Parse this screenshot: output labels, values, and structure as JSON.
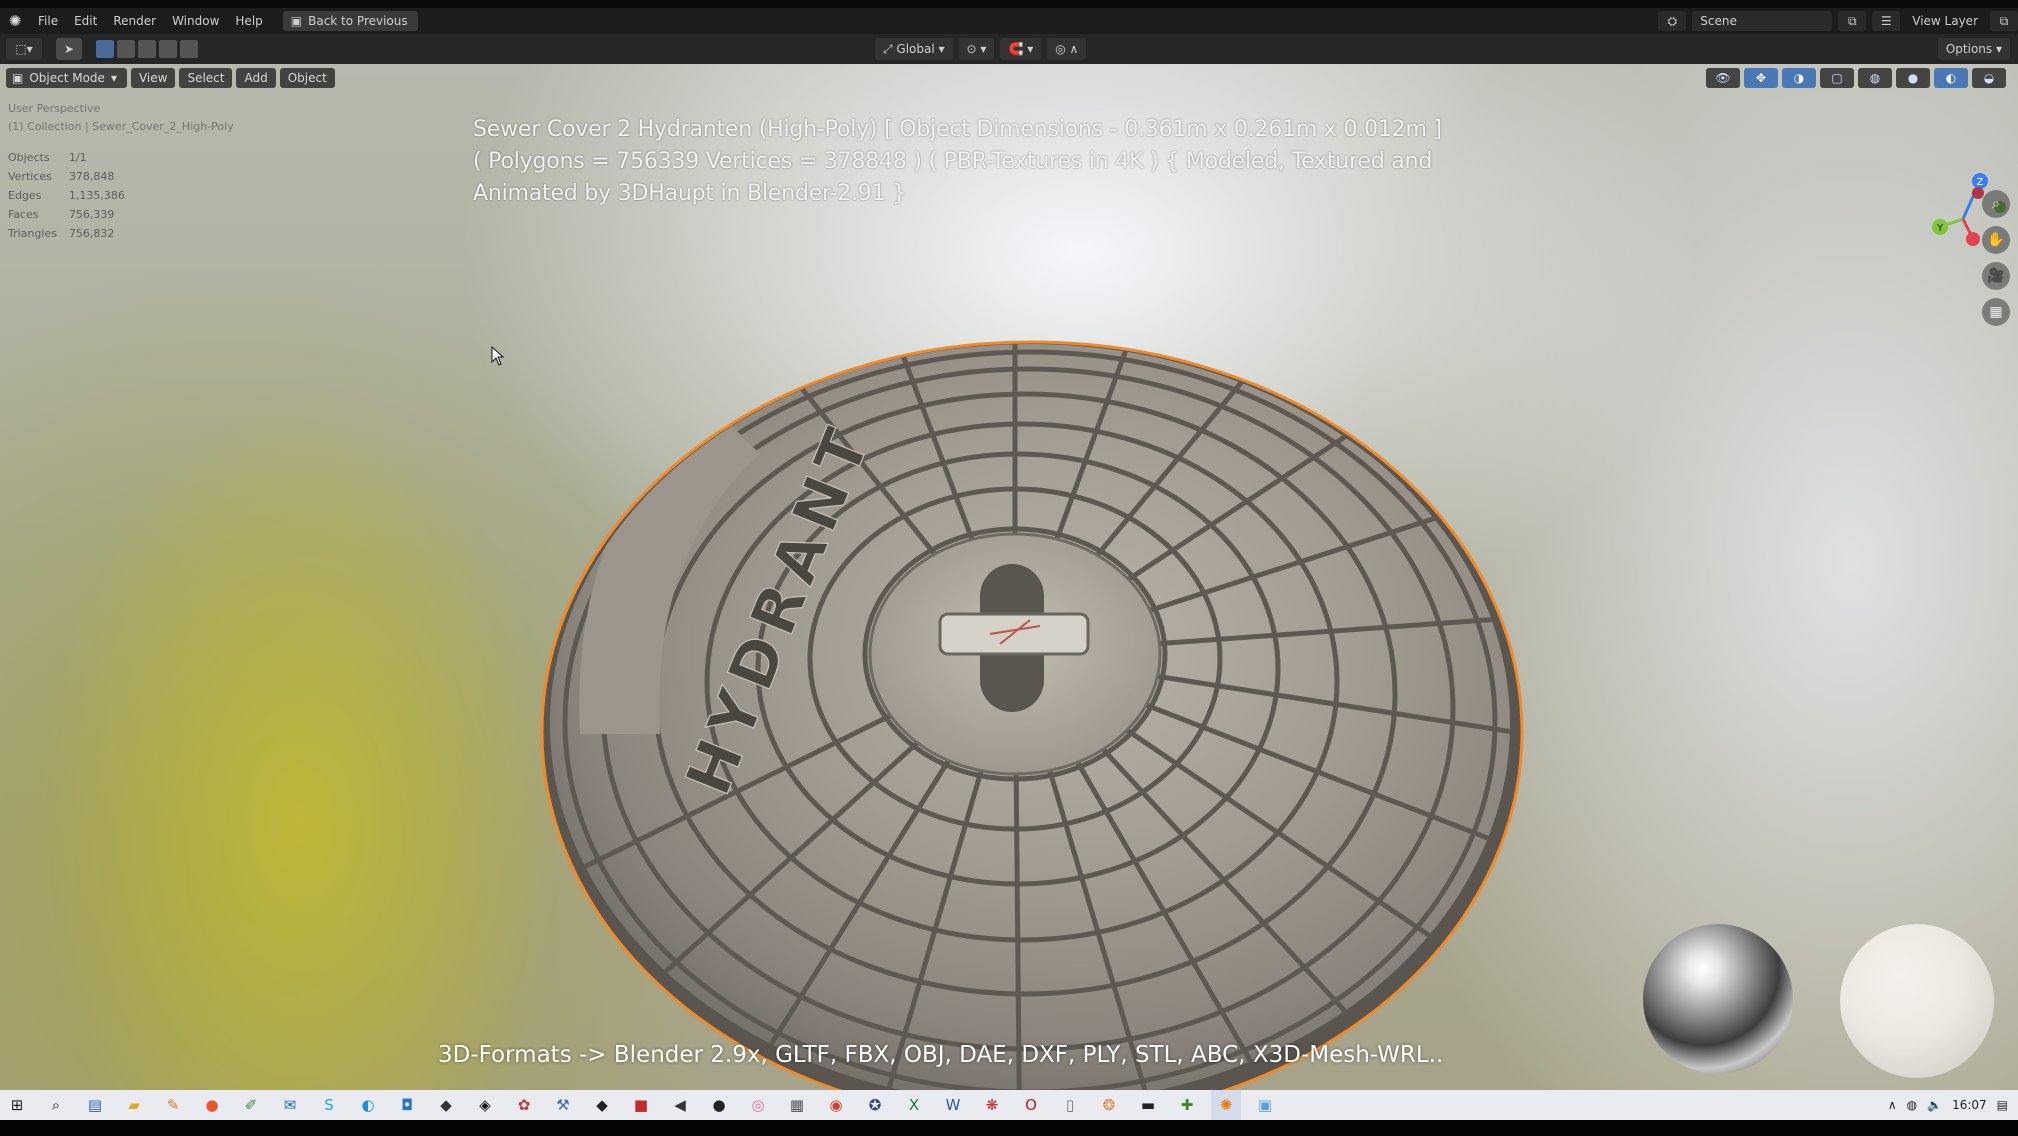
{
  "topbar": {
    "menus": [
      "File",
      "Edit",
      "Render",
      "Window",
      "Help"
    ],
    "back_button": "Back to Previous",
    "scene_name": "Scene",
    "view_layer": "View Layer"
  },
  "viewport_header": {
    "orientation": "Global",
    "options_label": "Options"
  },
  "viewport_menu": {
    "mode": "Object Mode",
    "items": [
      "View",
      "Select",
      "Add",
      "Object"
    ]
  },
  "overlay": {
    "perspective": "User Perspective",
    "collection": "(1) Collection | Sewer_Cover_2_High-Poly",
    "stats": [
      {
        "label": "Objects",
        "value": "1/1"
      },
      {
        "label": "Vertices",
        "value": "378,848"
      },
      {
        "label": "Edges",
        "value": "1,135,386"
      },
      {
        "label": "Faces",
        "value": "756,339"
      },
      {
        "label": "Triangles",
        "value": "756,832"
      }
    ]
  },
  "title_lines": [
    "Sewer Cover 2 Hydranten (High-Poly) [ Object Dimensions -  0.361m x 0.261m x 0.012m ]",
    "( Polygons = 756339 Vertices = 378848 ) ( PBR-Textures in 4K ) { Modeled, Textured and",
    "Animated by 3DHaupt in Blender-2.91 }"
  ],
  "formats_line": "3D-Formats -> Blender 2.9x, GLTF, FBX, OBJ, DAE, DXF, PLY, STL, ABC, X3D-Mesh-WRL..",
  "embossed_text": "HYDRANT",
  "gizmo_axes": {
    "x": "X",
    "y": "Y",
    "z": "Z"
  },
  "colors": {
    "gizmo_x": "#e2434f",
    "gizmo_y": "#7fc73a",
    "gizmo_z": "#3a7ff0",
    "selection_outline": "#f08a2a"
  },
  "taskbar": {
    "clock": "16:07"
  }
}
